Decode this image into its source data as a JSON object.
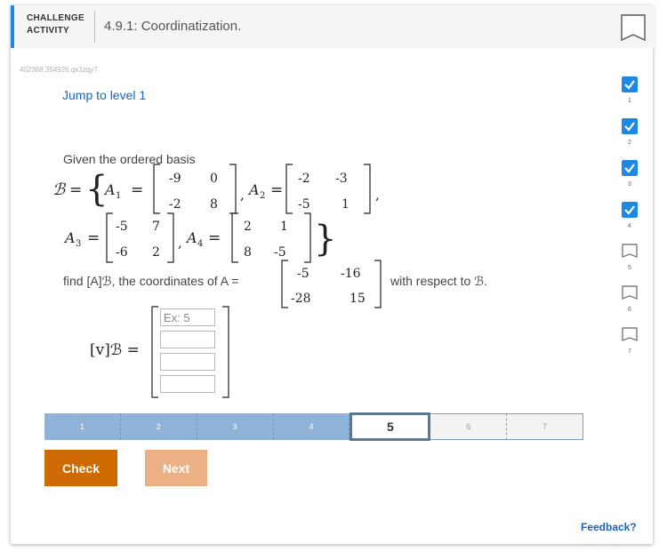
{
  "header": {
    "label_line1": "CHALLENGE",
    "label_line2": "ACTIVITY",
    "title": "4.9.1: Coordinatization."
  },
  "problem_code": "402368.354926.qx3zqy7",
  "jump_link": "Jump to level 1",
  "problem": {
    "basis_intro": "Given the ordered basis",
    "find_text": "find [A]ℬ, the coordinates of A =",
    "respect_text": "with respect to ℬ.",
    "A1": [
      [
        "-9",
        "0"
      ],
      [
        "-2",
        "8"
      ]
    ],
    "A2": [
      [
        "-2",
        "-3"
      ],
      [
        "-5",
        "1"
      ]
    ],
    "A3": [
      [
        "-5",
        "7"
      ],
      [
        "-6",
        "2"
      ]
    ],
    "A4": [
      [
        "2",
        "1"
      ],
      [
        "8",
        "-5"
      ]
    ],
    "A": [
      [
        "-5",
        "-16"
      ],
      [
        "-28",
        "15"
      ]
    ],
    "answer_label": "[v]ℬ =",
    "answer_inputs": [
      {
        "value": "",
        "placeholder": "Ex: 5"
      },
      {
        "value": "",
        "placeholder": ""
      },
      {
        "value": "",
        "placeholder": ""
      },
      {
        "value": "",
        "placeholder": ""
      }
    ]
  },
  "levels": [
    {
      "label": "1",
      "state": "done"
    },
    {
      "label": "2",
      "state": "done"
    },
    {
      "label": "3",
      "state": "done"
    },
    {
      "label": "4",
      "state": "done"
    },
    {
      "label": "5",
      "state": "current"
    },
    {
      "label": "6",
      "state": "todo"
    },
    {
      "label": "7",
      "state": "todo"
    }
  ],
  "buttons": {
    "check": "Check",
    "next": "Next"
  },
  "feedback": "Feedback?",
  "progress": [
    {
      "num": "1",
      "complete": true
    },
    {
      "num": "2",
      "complete": true
    },
    {
      "num": "3",
      "complete": true
    },
    {
      "num": "4",
      "complete": true
    },
    {
      "num": "5",
      "complete": false
    },
    {
      "num": "6",
      "complete": false
    },
    {
      "num": "7",
      "complete": false
    }
  ],
  "colors": {
    "accent": "#1e88e5",
    "check_button": "#cf6a00",
    "next_button": "#ebb184",
    "level_done": "#8fb2d9",
    "link": "#1565c0"
  }
}
